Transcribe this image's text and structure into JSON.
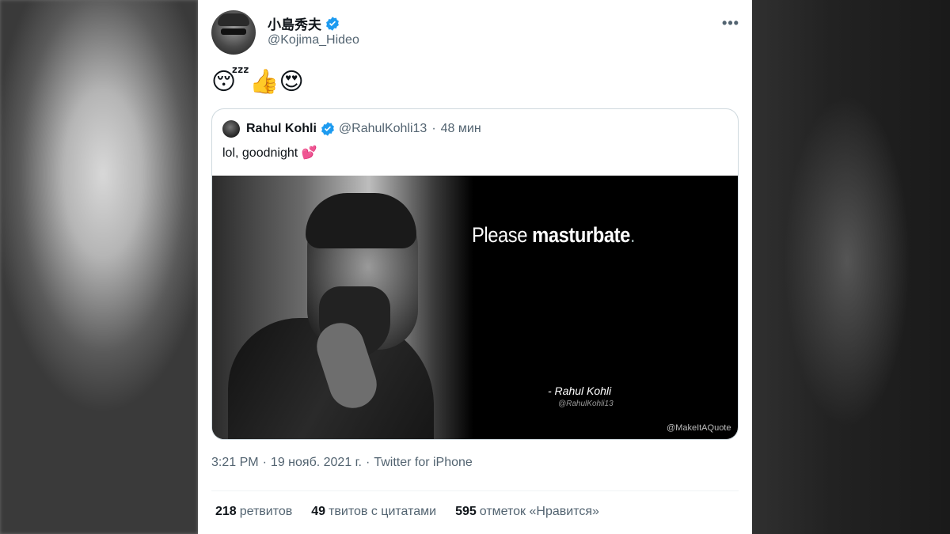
{
  "tweet": {
    "author": {
      "display_name": "小島秀夫",
      "handle": "@Kojima_Hideo",
      "verified": true
    },
    "more_icon": "more-horizontal-icon",
    "text": "😴👍😍",
    "quoted_tweet": {
      "author": {
        "display_name": "Rahul Kohli",
        "handle": "@RahulKohli13",
        "verified": true
      },
      "separator": "·",
      "time": "48 мин",
      "text": "lol, goodnight",
      "text_emoji": "💕",
      "image": {
        "quote_prefix": "Please ",
        "quote_emphasis": "masturbate",
        "quote_suffix": ".",
        "attribution": "- Rahul Kohli",
        "attribution_handle": "@RahulKohli13",
        "watermark": "@MakeItAQuote"
      }
    },
    "meta": {
      "time": "3:21 PM",
      "sep1": "·",
      "date": "19 нояб. 2021 г.",
      "sep2": "·",
      "source": "Twitter for iPhone"
    },
    "stats": {
      "retweets": {
        "count": "218",
        "label": "ретвитов"
      },
      "quotes": {
        "count": "49",
        "label": "твитов с цитатами"
      },
      "likes": {
        "count": "595",
        "label": "отметок «Нравится»"
      }
    }
  },
  "colors": {
    "verified": "#1d9bf0",
    "secondary_text": "#536471",
    "primary_text": "#0f1419",
    "border": "#cfd9de"
  }
}
